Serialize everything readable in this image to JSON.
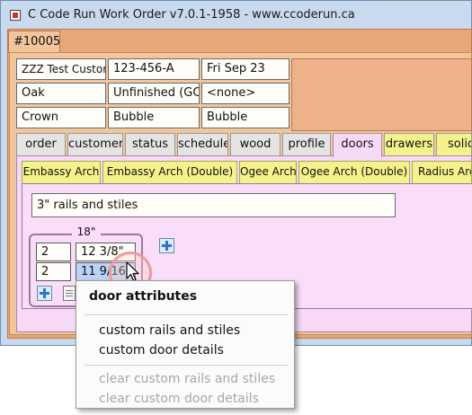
{
  "window": {
    "title": "C Code Run Work Order v7.0.1-1958 - www.ccoderun.ca",
    "doc_tab": "#10005"
  },
  "header": {
    "customer": "ZZZ Test Customer",
    "phone": "123-456-A",
    "date": "Fri Sep 23",
    "wood": "Oak",
    "finish": "Unfinished (GC)",
    "none": "<none>",
    "moulding": "Crown",
    "style1": "Bubble",
    "style2": "Bubble"
  },
  "main_tabs": [
    {
      "label": "order"
    },
    {
      "label": "customer"
    },
    {
      "label": "status"
    },
    {
      "label": "schedule"
    },
    {
      "label": "wood"
    },
    {
      "label": "profile"
    },
    {
      "label": "doors",
      "active": true
    },
    {
      "label": "drawers",
      "highlight": true
    },
    {
      "label": "solid",
      "highlight": true
    }
  ],
  "door_tabs": [
    {
      "label": "Embassy Arch"
    },
    {
      "label": "Embassy Arch (Double)"
    },
    {
      "label": "Ogee Arch"
    },
    {
      "label": "Ogee Arch (Double)"
    },
    {
      "label": "Radius Arch"
    }
  ],
  "doors": {
    "description": "3\" rails and stiles",
    "width_label": "18\"",
    "rows": [
      {
        "qty": "2",
        "height": "12 3/8\""
      },
      {
        "qty": "2",
        "height": "11 9/16\""
      }
    ]
  },
  "context_menu": {
    "heading": "door attributes",
    "items": [
      {
        "label": "custom rails and stiles",
        "enabled": true
      },
      {
        "label": "custom door details",
        "enabled": true
      },
      {
        "label": "clear custom rails and stiles",
        "enabled": false
      },
      {
        "label": "clear custom door details",
        "enabled": false
      }
    ]
  },
  "colors": {
    "orange_panel": "#e9a779",
    "pink_panel": "#f6d9f6",
    "tab_highlight": "#f4f28a",
    "selection": "#bcd2f5"
  }
}
